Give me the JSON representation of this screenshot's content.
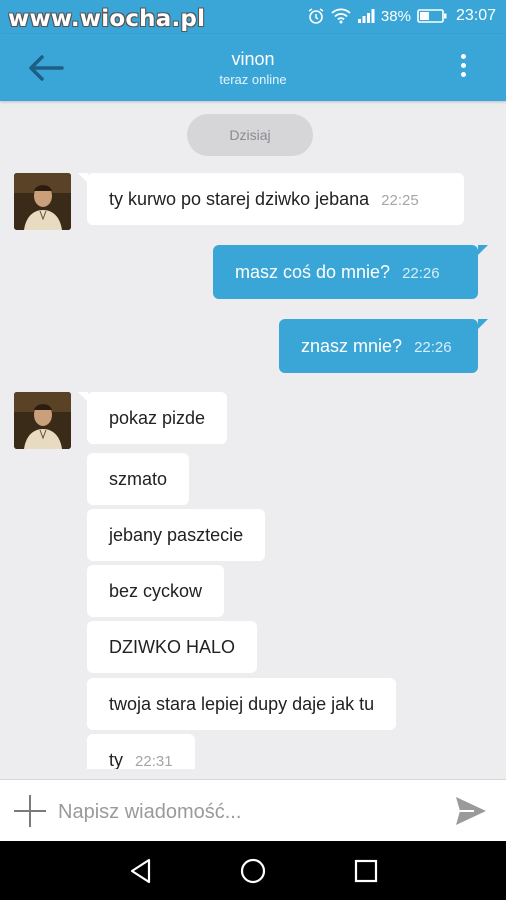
{
  "watermark": "www.wiocha.pl",
  "status": {
    "battery": "38%",
    "time": "23:07"
  },
  "header": {
    "title": "vinon",
    "subtitle": "teraz online"
  },
  "date_divider": "Dzisiaj",
  "messages": [
    {
      "text": "ty kurwo po starej dziwko jebana",
      "time": "22:25"
    },
    {
      "text": "masz coś do mnie?",
      "time": "22:26"
    },
    {
      "text": "znasz mnie?",
      "time": "22:26"
    },
    {
      "text": "pokaz pizde"
    },
    {
      "text": "szmato"
    },
    {
      "text": "jebany pasztecie"
    },
    {
      "text": "bez cyckow"
    },
    {
      "text": "DZIWKO HALO"
    },
    {
      "text": "twoja stara lepiej dupy daje jak tu"
    },
    {
      "text": "ty",
      "time": "22:31"
    }
  ],
  "composer": {
    "placeholder": "Napisz wiadomość..."
  },
  "colors": {
    "accent": "#3aa6d8",
    "background": "#ededef"
  }
}
